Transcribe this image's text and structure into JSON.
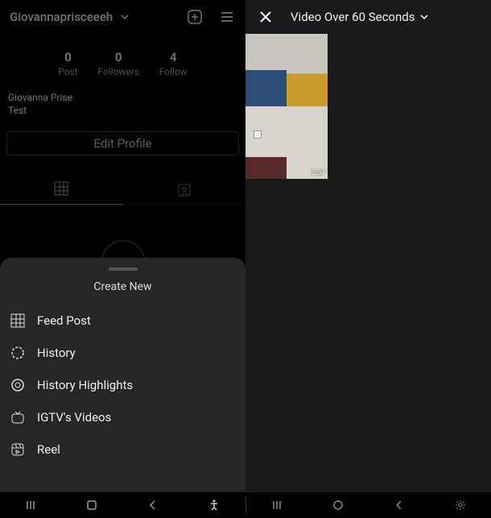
{
  "profile": {
    "username": "Giovannaprisceeeh",
    "stats": {
      "posts": {
        "count": "0",
        "label": "Post"
      },
      "followers": {
        "count": "0",
        "label": "Followers"
      },
      "following": {
        "count": "4",
        "label": "Follow"
      }
    },
    "display_name": "Giovanna Prise",
    "bio_line2": "Test",
    "edit_button": "Edit Profile"
  },
  "sheet": {
    "title": "Create New",
    "items": [
      {
        "icon": "grid-icon",
        "label": "Feed Post"
      },
      {
        "icon": "history-icon",
        "label": "History"
      },
      {
        "icon": "highlights-icon",
        "label": "History Highlights"
      },
      {
        "icon": "igtv-icon",
        "label": "IGTV's Videos"
      },
      {
        "icon": "reel-icon",
        "label": "Reel"
      }
    ]
  },
  "picker": {
    "title": "Video Over 60 Seconds",
    "thumbs": [
      {
        "duration": ""
      },
      {
        "duration": ""
      },
      {
        "duration": ""
      },
      {
        "duration": "5:57"
      }
    ]
  }
}
